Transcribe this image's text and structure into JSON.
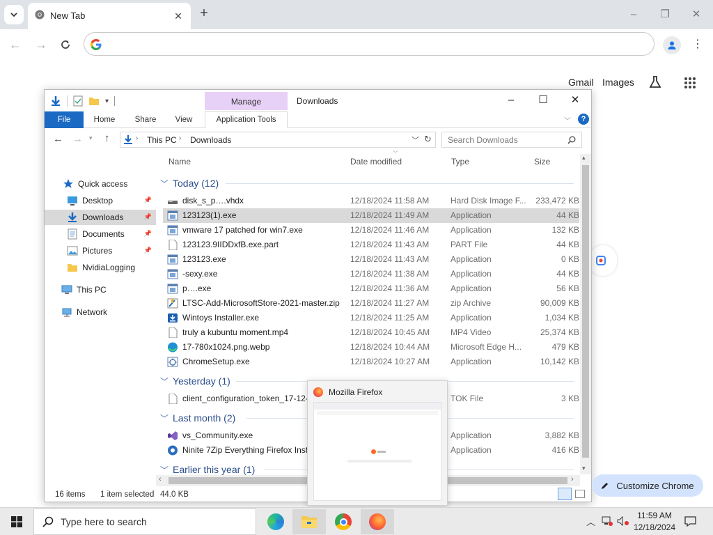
{
  "browser": {
    "tab_title": "New Tab",
    "new_tab_symbol": "+",
    "close_symbol": "✕",
    "links": {
      "gmail": "Gmail",
      "images": "Images"
    },
    "customize_label": "Customize Chrome"
  },
  "explorer": {
    "title": "Downloads",
    "manage_label": "Manage",
    "ribbon_tabs": [
      "File",
      "Home",
      "Share",
      "View",
      "Application Tools"
    ],
    "breadcrumb": [
      "This PC",
      "Downloads"
    ],
    "search_placeholder": "Search Downloads",
    "columns": {
      "name": "Name",
      "date": "Date modified",
      "type": "Type",
      "size": "Size"
    },
    "nav": [
      {
        "label": "Quick access",
        "icon": "star-icon",
        "pinned": false
      },
      {
        "label": "Desktop",
        "icon": "desktop-icon",
        "pinned": true
      },
      {
        "label": "Downloads",
        "icon": "download-icon",
        "pinned": true,
        "selected": true
      },
      {
        "label": "Documents",
        "icon": "documents-icon",
        "pinned": true
      },
      {
        "label": "Pictures",
        "icon": "pictures-icon",
        "pinned": true
      },
      {
        "label": "NvidiaLogging",
        "icon": "folder-icon",
        "pinned": false
      },
      {
        "label": "This PC",
        "icon": "pc-icon",
        "pinned": false
      },
      {
        "label": "Network",
        "icon": "network-icon",
        "pinned": false
      }
    ],
    "groups": [
      {
        "label": "Today (12)",
        "files": [
          {
            "name": "disk_s_p….vhdx",
            "date": "12/18/2024 11:58 AM",
            "type": "Hard Disk Image F...",
            "size": "233,472 KB",
            "icon": "vhd"
          },
          {
            "name": "123123(1).exe",
            "date": "12/18/2024 11:49 AM",
            "type": "Application",
            "size": "44 KB",
            "icon": "exe",
            "selected": true
          },
          {
            "name": "vmware 17 patched for win7.exe",
            "date": "12/18/2024 11:46 AM",
            "type": "Application",
            "size": "132 KB",
            "icon": "exe"
          },
          {
            "name": "123123.9IIDDxfB.exe.part",
            "date": "12/18/2024 11:43 AM",
            "type": "PART File",
            "size": "44 KB",
            "icon": "blank"
          },
          {
            "name": "123123.exe",
            "date": "12/18/2024 11:43 AM",
            "type": "Application",
            "size": "0 KB",
            "icon": "exe"
          },
          {
            "name": "-sexy.exe",
            "date": "12/18/2024 11:38 AM",
            "type": "Application",
            "size": "44 KB",
            "icon": "exe"
          },
          {
            "name": "p….exe",
            "date": "12/18/2024 11:36 AM",
            "type": "Application",
            "size": "56 KB",
            "icon": "exe"
          },
          {
            "name": "LTSC-Add-MicrosoftStore-2021-master.zip",
            "date": "12/18/2024 11:27 AM",
            "type": "zip Archive",
            "size": "90,009 KB",
            "icon": "zip"
          },
          {
            "name": "Wintoys Installer.exe",
            "date": "12/18/2024 11:25 AM",
            "type": "Application",
            "size": "1,034 KB",
            "icon": "installer"
          },
          {
            "name": "truly a kubuntu moment.mp4",
            "date": "12/18/2024 10:45 AM",
            "type": "MP4 Video",
            "size": "25,374 KB",
            "icon": "blank"
          },
          {
            "name": "17-780x1024.png.webp",
            "date": "12/18/2024 10:44 AM",
            "type": "Microsoft Edge H...",
            "size": "479 KB",
            "icon": "edge"
          },
          {
            "name": "ChromeSetup.exe",
            "date": "12/18/2024 10:27 AM",
            "type": "Application",
            "size": "10,142 KB",
            "icon": "setup"
          }
        ]
      },
      {
        "label": "Yesterday (1)",
        "files": [
          {
            "name": "client_configuration_token_17-12-",
            "date": "",
            "type": "TOK File",
            "size": "3 KB",
            "icon": "blank"
          }
        ]
      },
      {
        "label": "Last month (2)",
        "files": [
          {
            "name": "vs_Community.exe",
            "date": "",
            "type": "Application",
            "size": "3,882 KB",
            "icon": "vs"
          },
          {
            "name": "Ninite 7Zip Everything Firefox Inst",
            "date": "",
            "type": "Application",
            "size": "416 KB",
            "icon": "ninite"
          }
        ]
      },
      {
        "label": "Earlier this year (1)",
        "files": []
      }
    ],
    "status": {
      "count": "16 items",
      "selection": "1 item selected",
      "size": "44.0 KB"
    }
  },
  "preview": {
    "title": "Mozilla Firefox"
  },
  "taskbar": {
    "search_placeholder": "Type here to search",
    "time": "11:59 AM",
    "date": "12/18/2024"
  }
}
